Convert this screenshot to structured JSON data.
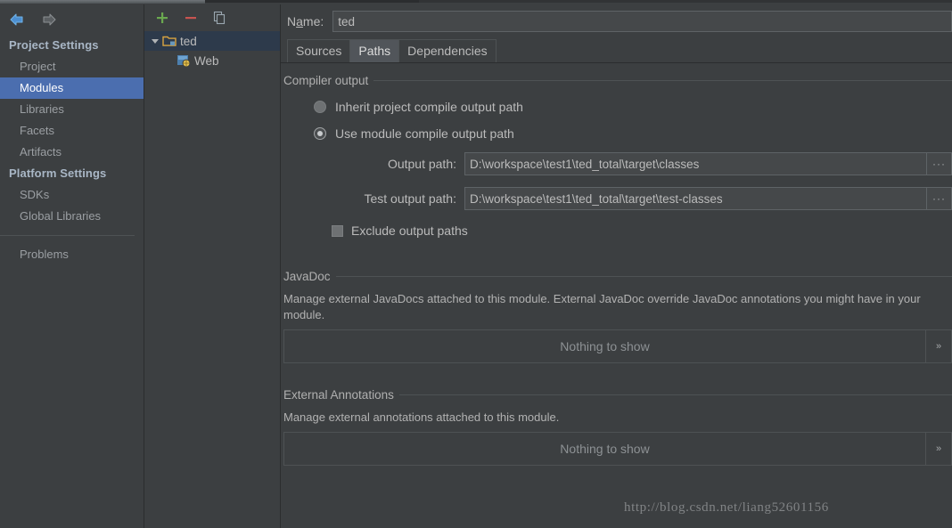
{
  "nav": {
    "back_icon": "arrow-left-icon",
    "forward_icon": "arrow-right-icon"
  },
  "sidebar": {
    "groups": [
      {
        "title": "Project Settings",
        "items": [
          {
            "label": "Project",
            "selected": false
          },
          {
            "label": "Modules",
            "selected": true
          },
          {
            "label": "Libraries",
            "selected": false
          },
          {
            "label": "Facets",
            "selected": false
          },
          {
            "label": "Artifacts",
            "selected": false
          }
        ]
      },
      {
        "title": "Platform Settings",
        "items": [
          {
            "label": "SDKs",
            "selected": false
          },
          {
            "label": "Global Libraries",
            "selected": false
          }
        ]
      }
    ],
    "problems_label": "Problems"
  },
  "tree": {
    "toolbar": [
      {
        "name": "add-module-button",
        "glyph": "+"
      },
      {
        "name": "remove-module-button",
        "glyph": "–"
      },
      {
        "name": "copy-module-button",
        "glyph": "copy-icon"
      }
    ],
    "nodes": [
      {
        "label": "ted",
        "icon": "module-folder-icon",
        "selected": true,
        "expanded": true
      },
      {
        "label": "Web",
        "icon": "web-facet-icon",
        "selected": false,
        "child": true
      }
    ]
  },
  "module": {
    "name_label": "Name:",
    "name_label_pre": "N",
    "name_label_mnemonic": "a",
    "name_label_post": "me:",
    "name_value": "ted",
    "name_placeholder": "",
    "tabs": [
      {
        "label": "Sources",
        "active": false
      },
      {
        "label": "Paths",
        "active": true
      },
      {
        "label": "Dependencies",
        "active": false
      }
    ]
  },
  "compiler_output": {
    "group_title": "Compiler output",
    "options": [
      {
        "label": "Inherit project compile output path",
        "checked": false
      },
      {
        "label": "Use module compile output path",
        "checked": true
      }
    ],
    "fields": [
      {
        "label": "Output path:",
        "value": "D:\\workspace\\test1\\ted_total\\target\\classes",
        "browse_glyph": "···"
      },
      {
        "label": "Test output path:",
        "value": "D:\\workspace\\test1\\ted_total\\target\\test-classes",
        "browse_glyph": "···"
      }
    ],
    "exclude": {
      "label": "Exclude output paths",
      "checked": false
    }
  },
  "javadoc": {
    "group_title": "JavaDoc",
    "description": "Manage external JavaDocs attached to this module. External JavaDoc override JavaDoc annotations you might have in your module.",
    "empty_text": "Nothing to show",
    "expand_glyph": "»"
  },
  "external_annotations": {
    "group_title": "External Annotations",
    "description": "Manage external annotations attached to this module.",
    "empty_text": "Nothing to show",
    "expand_glyph": "»"
  },
  "watermark": {
    "text": "http://blog.csdn.net/liang52601156"
  },
  "colors": {
    "background": "#3c3f41",
    "selection_blue": "#4b6eaf",
    "tree_selection": "#2d3a4b",
    "text": "#bbbbbb",
    "border": "#4e5254",
    "field_bg": "#45484a",
    "add_green": "#6aa84f",
    "remove_red": "#c75450"
  }
}
